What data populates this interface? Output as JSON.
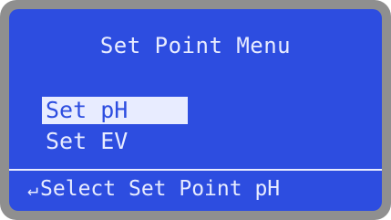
{
  "screen": {
    "title": "Set Point Menu",
    "menu": {
      "items": [
        {
          "label": "Set pH",
          "selected": true
        },
        {
          "label": "Set EV",
          "selected": false
        }
      ]
    },
    "footer": {
      "icon": "enter-icon",
      "icon_glyph": "↵",
      "text": "Select Set Point pH"
    }
  },
  "colors": {
    "bezel": "#8f8f8f",
    "screen_background": "#2d4de0",
    "text": "#e8ecff"
  }
}
